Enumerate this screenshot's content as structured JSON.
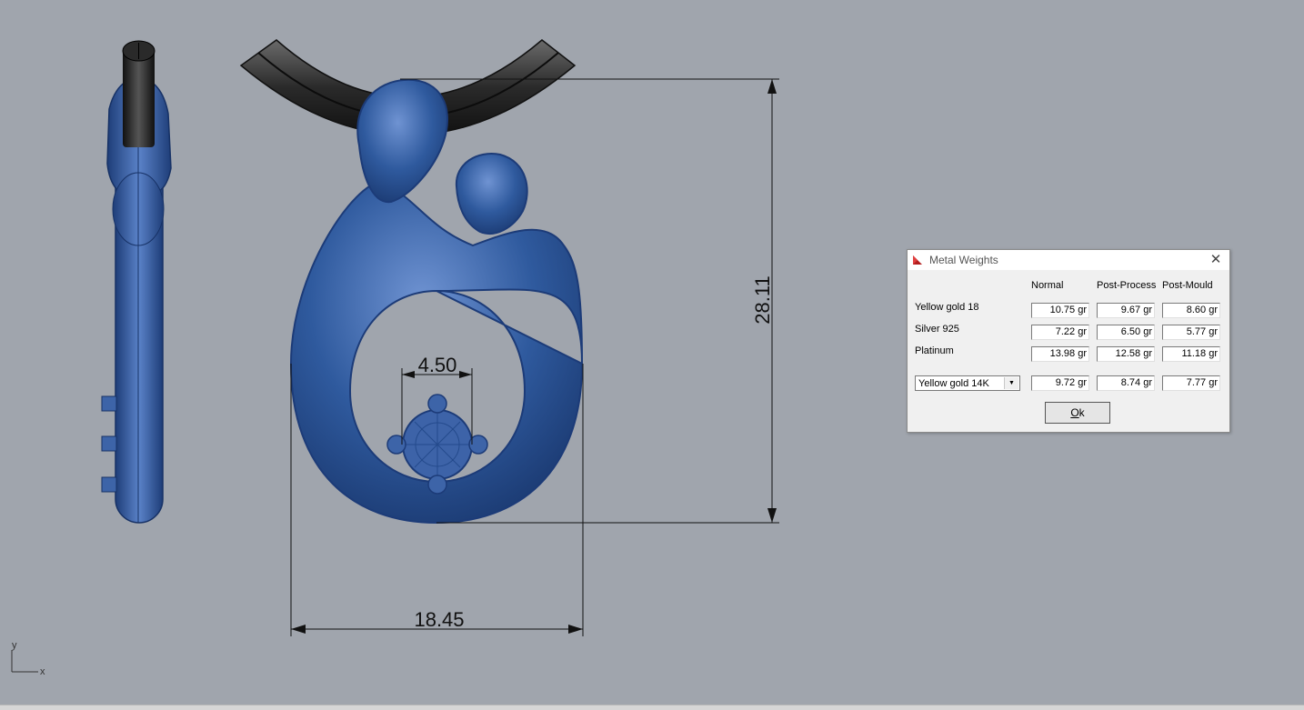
{
  "viewport": {
    "dimensions": {
      "height": "28.11",
      "width": "18.45",
      "stone": "4.50"
    },
    "axis": {
      "x": "x",
      "y": "y"
    }
  },
  "dialog": {
    "title": "Metal Weights",
    "columns": [
      "Normal",
      "Post-Process",
      "Post-Mould"
    ],
    "rows": [
      {
        "label": "Yellow gold 18",
        "values": [
          "10.75 gr",
          "9.67 gr",
          "8.60 gr"
        ]
      },
      {
        "label": "Silver 925",
        "values": [
          "7.22 gr",
          "6.50 gr",
          "5.77 gr"
        ]
      },
      {
        "label": "Platinum",
        "values": [
          "13.98 gr",
          "12.58 gr",
          "11.18 gr"
        ]
      }
    ],
    "custom": {
      "selected": "Yellow gold 14K",
      "values": [
        "9.72 gr",
        "8.74 gr",
        "7.77 gr"
      ]
    },
    "ok_label": "Ok",
    "ok_mnemonic": "O",
    "ok_rest": "k"
  },
  "colors": {
    "metal": "#2f5a9e",
    "chain": "#2e2e2e",
    "background": "#a0a5ad"
  }
}
